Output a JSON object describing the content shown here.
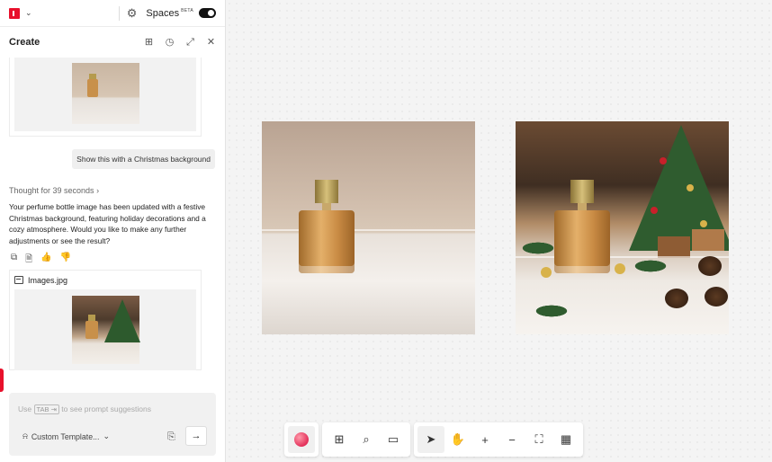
{
  "topbar": {
    "spaces_label": "Spaces",
    "beta_label": "BETA",
    "spaces_toggle_on": true
  },
  "create": {
    "title": "Create"
  },
  "chat": {
    "user_message": "Show this with a Christmas background",
    "thought_label": "Thought for 39 seconds",
    "assistant_reply": "Your perfume bottle image has been updated with a festive Christmas background, featuring holiday decorations and a cozy atmosphere. Would you like to make any further adjustments or see the result?",
    "file_name": "Images.jpg"
  },
  "prompt": {
    "hint_before": "Use",
    "hint_key": "TAB",
    "hint_after": "to see prompt suggestions",
    "template_label": "Custom Template..."
  },
  "colors": {
    "accent": "#e8102b"
  },
  "icons": {
    "topbar": [
      "logo-icon",
      "chevron-down-icon",
      "gear-icon",
      "toggle"
    ],
    "create_header": [
      "add-panel-icon",
      "history-icon",
      "expand-icon",
      "close-icon"
    ],
    "message_actions": [
      "copy-icon",
      "document-icon",
      "thumbs-up-icon",
      "thumbs-down-icon"
    ],
    "toolbar": [
      "color-orb",
      "add-file-icon",
      "search-icon",
      "comment-icon",
      "pointer-icon",
      "hand-icon",
      "zoom-in-icon",
      "zoom-out-icon",
      "fit-screen-icon",
      "grid-icon"
    ]
  }
}
